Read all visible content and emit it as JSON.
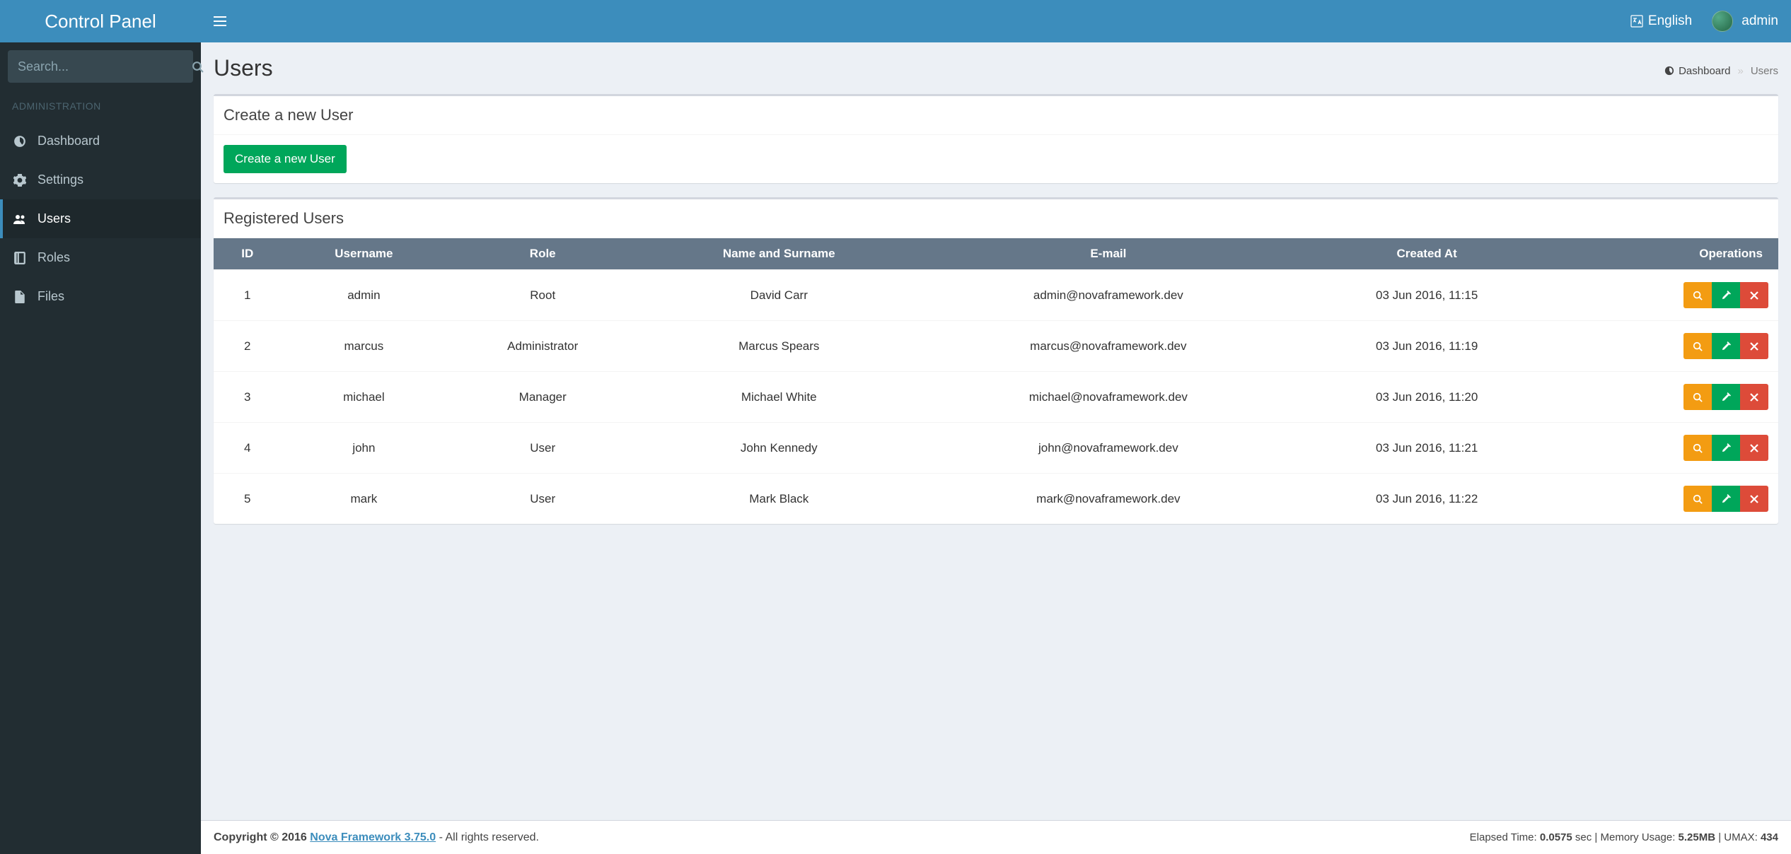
{
  "brand": "Control Panel",
  "search": {
    "placeholder": "Search..."
  },
  "sidebar": {
    "section_label": "ADMINISTRATION",
    "items": [
      {
        "label": "Dashboard",
        "icon": "dashboard-icon",
        "active": false
      },
      {
        "label": "Settings",
        "icon": "gear-icon",
        "active": false
      },
      {
        "label": "Users",
        "icon": "users-icon",
        "active": true
      },
      {
        "label": "Roles",
        "icon": "book-icon",
        "active": false
      },
      {
        "label": "Files",
        "icon": "file-icon",
        "active": false
      }
    ]
  },
  "topbar": {
    "language": "English",
    "username": "admin"
  },
  "page": {
    "title": "Users",
    "breadcrumb": {
      "home": "Dashboard",
      "current": "Users"
    }
  },
  "create_panel": {
    "header": "Create a new User",
    "button": "Create a new User"
  },
  "table_panel": {
    "header": "Registered Users",
    "columns": [
      "ID",
      "Username",
      "Role",
      "Name and Surname",
      "E-mail",
      "Created At",
      "Operations"
    ],
    "rows": [
      {
        "id": "1",
        "username": "admin",
        "role": "Root",
        "name": "David Carr",
        "email": "admin@novaframework.dev",
        "created": "03 Jun 2016, 11:15"
      },
      {
        "id": "2",
        "username": "marcus",
        "role": "Administrator",
        "name": "Marcus Spears",
        "email": "marcus@novaframework.dev",
        "created": "03 Jun 2016, 11:19"
      },
      {
        "id": "3",
        "username": "michael",
        "role": "Manager",
        "name": "Michael White",
        "email": "michael@novaframework.dev",
        "created": "03 Jun 2016, 11:20"
      },
      {
        "id": "4",
        "username": "john",
        "role": "User",
        "name": "John Kennedy",
        "email": "john@novaframework.dev",
        "created": "03 Jun 2016, 11:21"
      },
      {
        "id": "5",
        "username": "mark",
        "role": "User",
        "name": "Mark Black",
        "email": "mark@novaframework.dev",
        "created": "03 Jun 2016, 11:22"
      }
    ]
  },
  "footer": {
    "copyright_prefix": "Copyright © 2016 ",
    "framework": "Nova Framework 3.75.0",
    "copyright_suffix": " - All rights reserved.",
    "stats_prefix": "Elapsed Time: ",
    "elapsed": "0.0575",
    "stats_mid1": " sec | Memory Usage: ",
    "memory": "5.25MB",
    "stats_mid2": " | UMAX: ",
    "umax": "434"
  },
  "icons": {
    "search": "search-icon",
    "bars": "bars-icon",
    "globe": "globe-icon",
    "view": "search-icon",
    "edit": "pencil-icon",
    "delete": "x-icon"
  }
}
